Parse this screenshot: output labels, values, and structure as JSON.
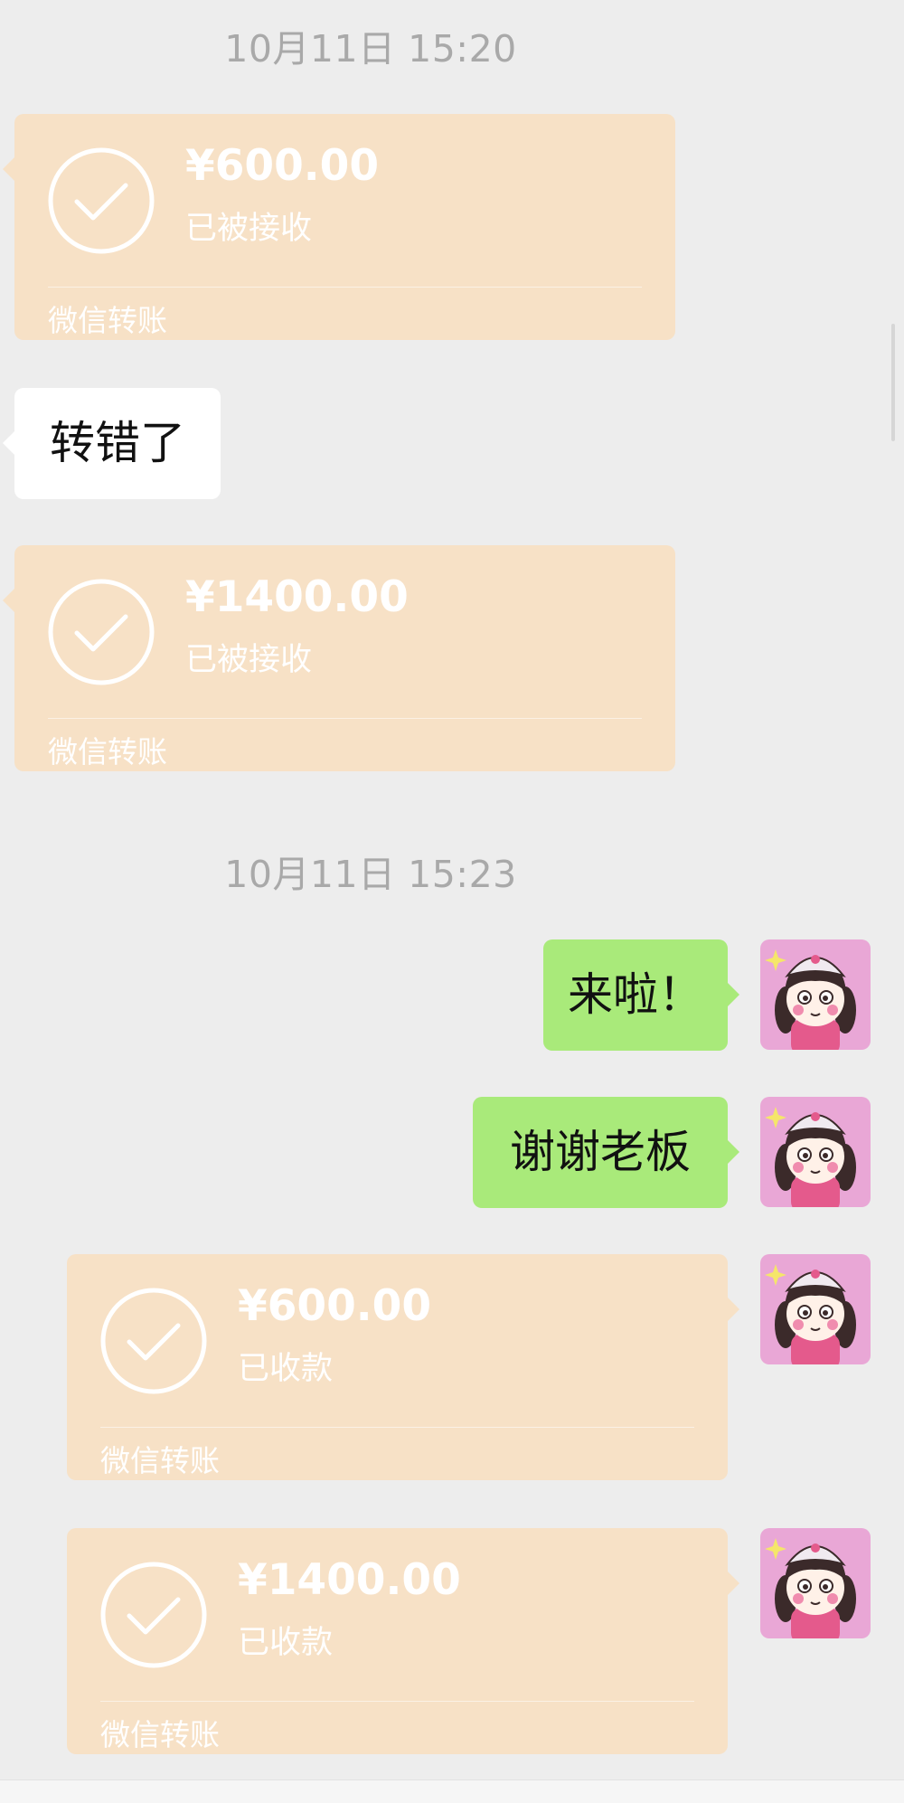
{
  "timestamps": [
    "10月11日 15:20",
    "10月11日 15:23"
  ],
  "messages": [
    {
      "kind": "transfer",
      "side": "left",
      "amount": "¥600.00",
      "status": "已被接收",
      "footer": "微信转账"
    },
    {
      "kind": "text",
      "side": "left",
      "text": "转错了"
    },
    {
      "kind": "transfer",
      "side": "left",
      "amount": "¥1400.00",
      "status": "已被接收",
      "footer": "微信转账"
    },
    {
      "kind": "text",
      "side": "right",
      "text": "来啦！"
    },
    {
      "kind": "text",
      "side": "right",
      "text": "谢谢老板"
    },
    {
      "kind": "transfer",
      "side": "right",
      "amount": "¥600.00",
      "status": "已收款",
      "footer": "微信转账"
    },
    {
      "kind": "transfer",
      "side": "right",
      "amount": "¥1400.00",
      "status": "已收款",
      "footer": "微信转账"
    }
  ],
  "icons": {
    "transfer_status": "check-circle-icon",
    "avatar": "cartoon-girl-avatar"
  },
  "colors": {
    "background": "#ededed",
    "transfer_bubble": "#f7e1c6",
    "sent_bubble": "#a9ea7a",
    "received_bubble": "#ffffff",
    "timestamp_text": "#a9a9a9",
    "avatar_background": "#e9a7d6"
  }
}
